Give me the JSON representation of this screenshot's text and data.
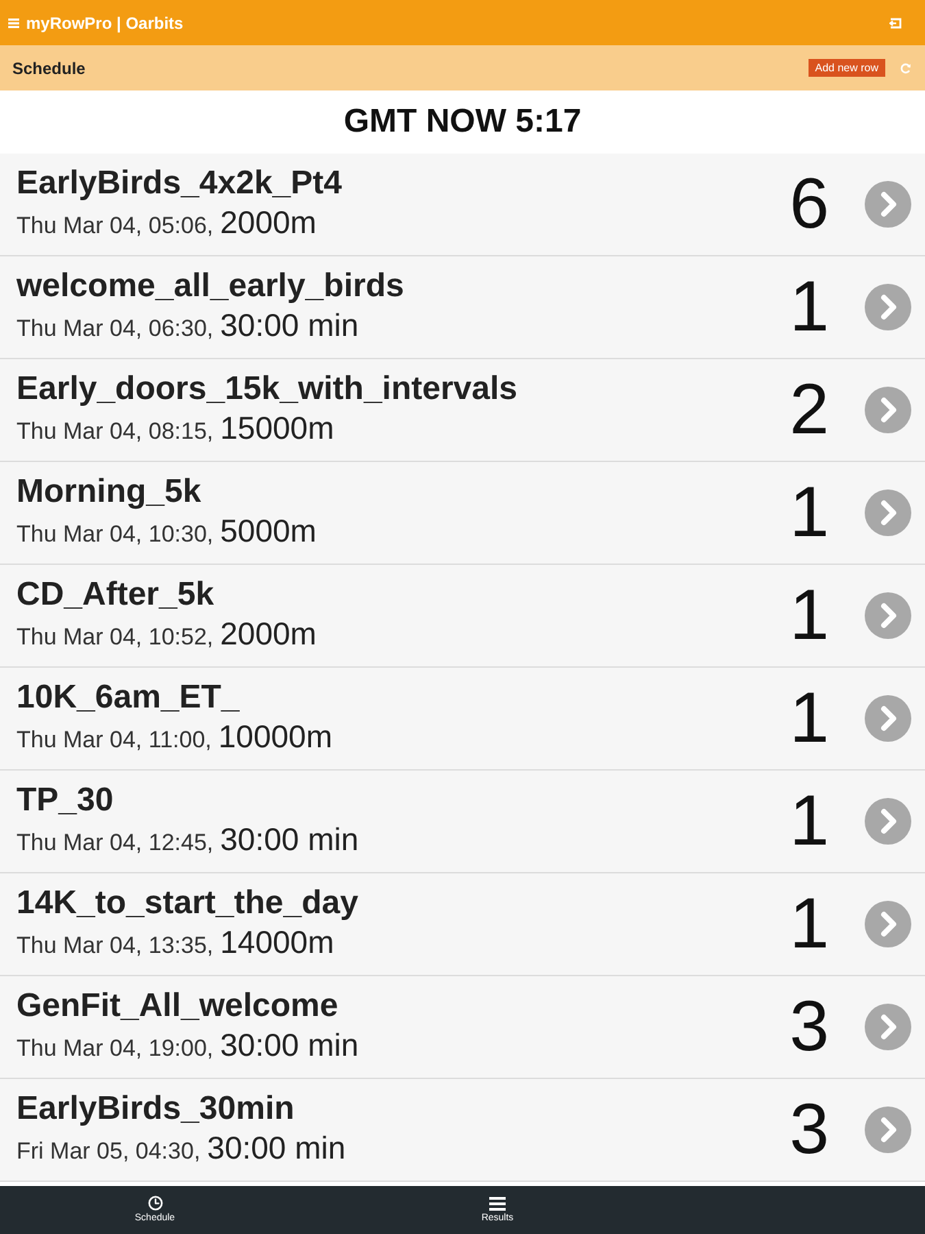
{
  "app_bar": {
    "title": "myRowPro | Oarbits"
  },
  "sub_bar": {
    "title": "Schedule",
    "add_button": "Add new row"
  },
  "clock": "GMT NOW 5:17",
  "sessions": [
    {
      "name": "EarlyBirds_4x2k_Pt4",
      "date": "Thu Mar 04, 05:06,",
      "target": "2000m",
      "count": "6"
    },
    {
      "name": "welcome_all_early_birds",
      "date": "Thu Mar 04, 06:30,",
      "target": "30:00 min",
      "count": "1"
    },
    {
      "name": "Early_doors_15k_with_intervals",
      "date": "Thu Mar 04, 08:15,",
      "target": "15000m",
      "count": "2"
    },
    {
      "name": "Morning_5k",
      "date": "Thu Mar 04, 10:30,",
      "target": "5000m",
      "count": "1"
    },
    {
      "name": "CD_After_5k",
      "date": "Thu Mar 04, 10:52,",
      "target": "2000m",
      "count": "1"
    },
    {
      "name": "10K_6am_ET_",
      "date": "Thu Mar 04, 11:00,",
      "target": "10000m",
      "count": "1"
    },
    {
      "name": "TP_30",
      "date": "Thu Mar 04, 12:45,",
      "target": "30:00 min",
      "count": "1"
    },
    {
      "name": "14K_to_start_the_day",
      "date": "Thu Mar 04, 13:35,",
      "target": "14000m",
      "count": "1"
    },
    {
      "name": "GenFit_All_welcome",
      "date": "Thu Mar 04, 19:00,",
      "target": "30:00 min",
      "count": "3"
    },
    {
      "name": "EarlyBirds_30min",
      "date": "Fri Mar 05, 04:30,",
      "target": "30:00 min",
      "count": "3"
    }
  ],
  "bottom_nav": [
    {
      "label": "Schedule"
    },
    {
      "label": "Results"
    }
  ]
}
